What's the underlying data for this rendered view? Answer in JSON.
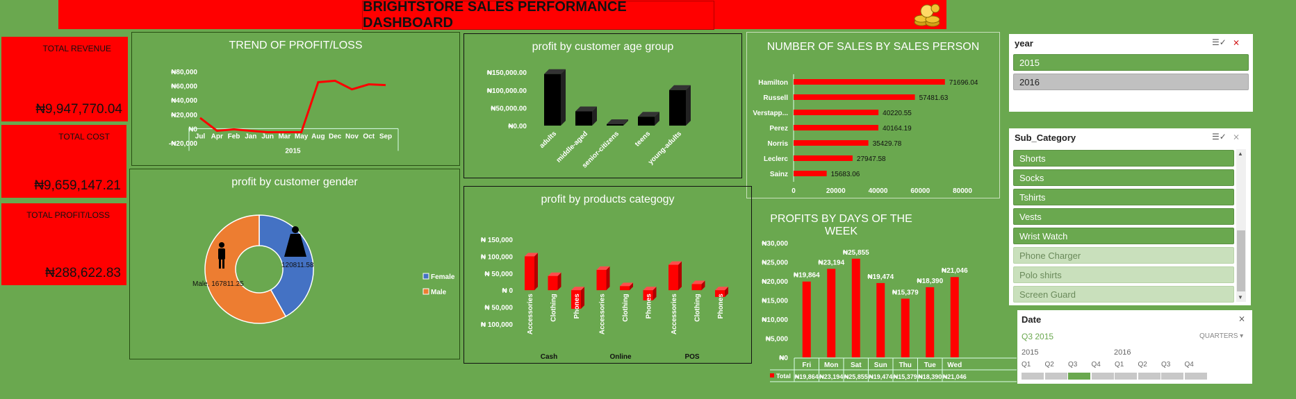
{
  "dashboard_title": "BRIGHTSTORE SALES PERFORMANCE DASHBOARD",
  "kpis": [
    {
      "label": "TOTAL REVENUE",
      "value": "₦9,947,770.04"
    },
    {
      "label": "TOTAL COST",
      "value": "₦9,659,147.21"
    },
    {
      "label": "TOTAL PROFIT/LOSS",
      "value": "₦288,622.83"
    }
  ],
  "colors": {
    "background": "#6aa84f",
    "accent": "#ff0000",
    "female": "#4472c4",
    "male": "#ed7d31"
  },
  "slicers": {
    "year": {
      "title": "year",
      "items": [
        {
          "label": "2015",
          "state": "selected"
        },
        {
          "label": "2016",
          "state": "grey"
        }
      ]
    },
    "sub_category": {
      "title": "Sub_Category",
      "items": [
        {
          "label": "Shorts",
          "state": "selected"
        },
        {
          "label": "Socks",
          "state": "selected"
        },
        {
          "label": "Tshirts",
          "state": "selected"
        },
        {
          "label": "Vests",
          "state": "selected"
        },
        {
          "label": "Wrist Watch",
          "state": "selected"
        },
        {
          "label": "Phone Charger",
          "state": "unselected"
        },
        {
          "label": "Polo shirts",
          "state": "unselected"
        },
        {
          "label": "Screen Guard",
          "state": "unselected"
        }
      ]
    },
    "date": {
      "title": "Date",
      "period": "Q3 2015",
      "level": "QUARTERS",
      "years": [
        "2015",
        "2016"
      ],
      "quarters": [
        "Q1",
        "Q2",
        "Q3",
        "Q4",
        "Q1",
        "Q2",
        "Q3",
        "Q4"
      ],
      "selected_quarter_index": 2
    }
  },
  "chart_data": [
    {
      "id": "profit_trend",
      "type": "line",
      "title": "TREND OF PROFIT/LOSS",
      "categories": [
        "Jul",
        "Apr",
        "Feb",
        "Jan",
        "Jun",
        "Mar",
        "May",
        "Aug",
        "Dec",
        "Nov",
        "Oct",
        "Sep"
      ],
      "group_label": "2015",
      "values": [
        15000,
        -3000,
        -1000,
        -3000,
        -5000,
        -5000,
        -5000,
        65000,
        67000,
        55000,
        62000,
        61000
      ],
      "ylim": [
        -20000,
        80000
      ],
      "yticks": [
        "-₦20,000",
        "₦0",
        "₦20,000",
        "₦40,000",
        "₦60,000",
        "₦80,000"
      ],
      "tick_values": [
        -20000,
        0,
        20000,
        40000,
        60000,
        80000
      ],
      "color": "#ff0000"
    },
    {
      "id": "age_group",
      "type": "bar",
      "title": "profit by customer age group",
      "categories": [
        "adults",
        "middle-aged",
        "senior-citizens",
        "teens",
        "young-adults"
      ],
      "values": [
        145000,
        40000,
        4000,
        25000,
        100000
      ],
      "ylim": [
        0,
        160000
      ],
      "yticks": [
        "₦0.00",
        "₦50,000.00",
        "₦100,000.00",
        "₦150,000.00"
      ],
      "tick_values": [
        0,
        50000,
        100000,
        150000
      ],
      "color": "#000000"
    },
    {
      "id": "salesperson",
      "type": "bar",
      "orientation": "horizontal",
      "title": "NUMBER OF SALES BY SALES PERSON",
      "categories": [
        "Hamilton",
        "Russell",
        "Verstapp...",
        "Perez",
        "Norris",
        "Leclerc",
        "Sainz"
      ],
      "values": [
        71696.04,
        57481.63,
        40220.55,
        40164.19,
        35429.78,
        27947.58,
        15683.06
      ],
      "labels": [
        "71696.04",
        "57481.63",
        "40220.55",
        "40164.19",
        "35429.78",
        "27947.58",
        "15683.06"
      ],
      "xlim": [
        0,
        80000
      ],
      "xticks": [
        "0",
        "20000",
        "40000",
        "60000",
        "80000"
      ],
      "tick_values": [
        0,
        20000,
        40000,
        60000,
        80000
      ],
      "color": "#ff0000"
    },
    {
      "id": "gender",
      "type": "pie",
      "title": "profit by customer gender",
      "slices": [
        {
          "name": "Female",
          "value": 120811.58,
          "label": "120811.58"
        },
        {
          "name": "Male",
          "value": 167811.25,
          "label": "Male, 167811.25"
        }
      ],
      "legend": [
        "Female",
        "Male"
      ]
    },
    {
      "id": "product_category",
      "type": "bar",
      "title": "profit by products categogy",
      "groups": [
        "Cash",
        "Online",
        "POS"
      ],
      "categories": [
        "Accessories",
        "Clothing",
        "Phones",
        "Accessories",
        "Clothing",
        "Phones",
        "Accessories",
        "Clothing",
        "Phones"
      ],
      "values": [
        100000,
        42000,
        -55000,
        60000,
        12000,
        -30000,
        75000,
        18000,
        -20000
      ],
      "ylim": [
        -100000,
        150000
      ],
      "yticks": [
        "₦ 100,000",
        "₦ 50,000",
        "₦ 0",
        "₦ 50,000",
        "₦ 100,000",
        "₦ 150,000"
      ],
      "tick_values": [
        -100000,
        -50000,
        0,
        50000,
        100000,
        150000
      ],
      "color": "#ff0000"
    },
    {
      "id": "weekday",
      "type": "bar",
      "title": "PROFITS BY DAYS OF THE WEEK",
      "categories": [
        "Fri",
        "Mon",
        "Sat",
        "Sun",
        "Thu",
        "Tue",
        "Wed"
      ],
      "values": [
        19864,
        23194,
        25855,
        19474,
        15379,
        18390,
        21046
      ],
      "labels": [
        "₦19,864",
        "₦23,194",
        "₦25,855",
        "₦19,474",
        "₦15,379",
        "₦18,390",
        "₦21,046"
      ],
      "ylim": [
        0,
        30000
      ],
      "yticks": [
        "₦0",
        "₦5,000",
        "₦10,000",
        "₦15,000",
        "₦20,000",
        "₦25,000",
        "₦30,000"
      ],
      "tick_values": [
        0,
        5000,
        10000,
        15000,
        20000,
        25000,
        30000
      ],
      "table_label": "Total",
      "color": "#ff0000"
    }
  ]
}
